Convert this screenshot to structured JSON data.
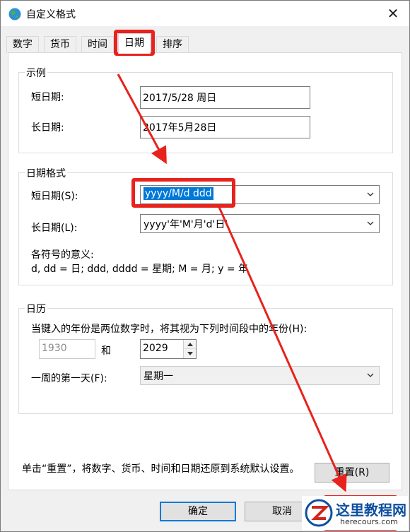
{
  "window": {
    "title": "自定义格式",
    "close_glyph": "✕"
  },
  "tabs": [
    {
      "label": "数字",
      "active": false
    },
    {
      "label": "货币",
      "active": false
    },
    {
      "label": "时间",
      "active": false
    },
    {
      "label": "日期",
      "active": true
    },
    {
      "label": "排序",
      "active": false
    }
  ],
  "examples": {
    "title": "示例",
    "short_label": "短日期:",
    "short_value": "2017/5/28 周日",
    "long_label": "长日期:",
    "long_value": "2017年5月28日"
  },
  "date_format": {
    "title": "日期格式",
    "short_label": "短日期(S):",
    "short_value": "yyyy/M/d ddd",
    "long_label": "长日期(L):",
    "long_value": "yyyy'年'M'月'd'日'",
    "meaning_title": "各符号的意义:",
    "meaning_text": "d, dd = 日;  ddd, dddd = 星期;  M = 月;  y = 年"
  },
  "calendar": {
    "title": "日历",
    "two_digit_text": "当键入的年份是两位数字时，将其视为下列时间段中的年份(H):",
    "start_year": "1930",
    "and_label": "和",
    "end_year": "2029",
    "first_day_label": "一周的第一天(F):",
    "first_day_value": "星期一"
  },
  "reset": {
    "note": "单击“重置”，将数字、货币、时间和日期还原到系统默认设置。",
    "button_label": "重置(R)"
  },
  "footer": {
    "ok_label": "确定",
    "cancel_label": "取消"
  },
  "watermark": {
    "title": "这里教程网",
    "url": "herecours.com"
  },
  "colors": {
    "highlight": "#e8221d",
    "selection": "#0078d7",
    "accent_blue": "#0078d7"
  }
}
